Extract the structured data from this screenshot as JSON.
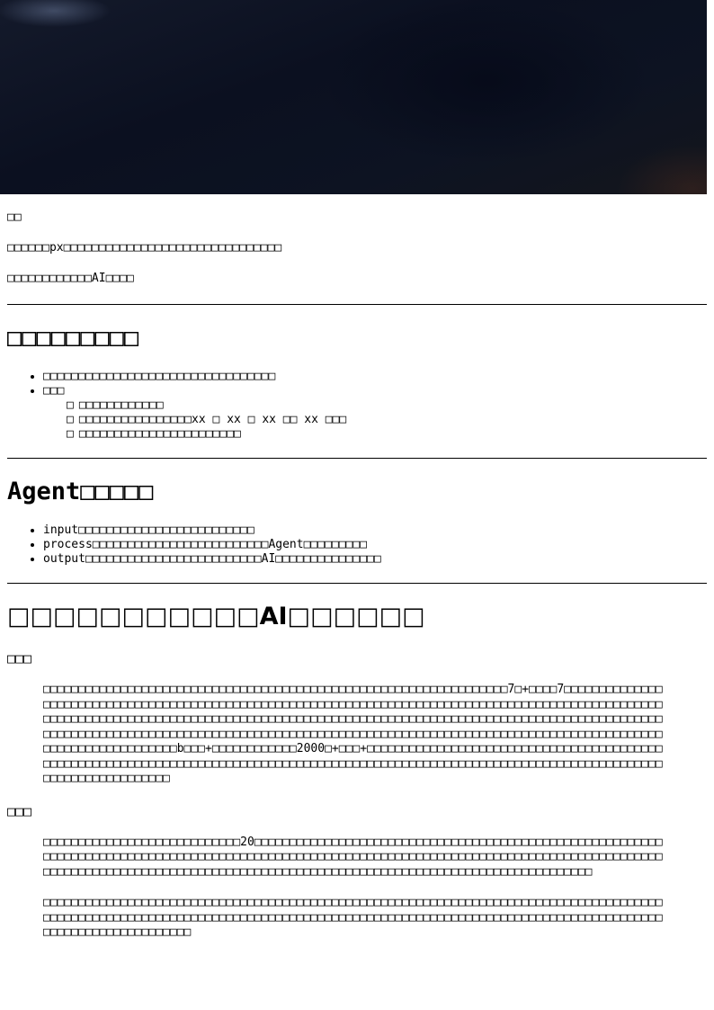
{
  "hero": {
    "image": "dark-night-banner"
  },
  "intro": {
    "line1": "□□",
    "line2_a": "□□□□□□px□□□□",
    "line2_b": "□□□□□□□□□",
    "line2_c": "□□□□□□□□□□□□□□□□□□",
    "line3": "□□□□□□□□□□□□AI□□□□"
  },
  "section1": {
    "title": "□□□□□□□□□",
    "items": [
      "□□□□□□□□□□□□□□□□□□□□□□□□□□□□□□□□□",
      "□□□"
    ],
    "subitems": [
      "□□□□□□□□□□□□",
      "□□□□□□□□□□□□□□□□xx □ xx □ xx □□ xx □□□",
      "□□□□□□□□□□□□□□□□□□□□□□□"
    ]
  },
  "section2": {
    "title": "Agent□□□□□",
    "items": [
      "input□□□□□□□□□□□□□□□□□□□□□□□□□",
      "process□□□□□□□□□□□□□□□□□□□□□□□□□Agent□□□□□□□□□",
      "output□□□□□□□□□□□□□□□□□□□□□□□□□AI□□□□□□□□□□□□□□□"
    ]
  },
  "section3": {
    "title": "□□□□□□□□□□□AI□□□□□□",
    "sub1": {
      "heading": "□□□",
      "body": "□□□□□□□□□□□□□□□□□□□□□□□□□□□□□□□□□□□□□□□□□□□□□□□□□□□□□□□□□□□□□□□□□□7□+□□□□7□□□□□□□□□□□□□□□□□□□□□□□□□□□□□□□□□□□□□□□□□□□□□□□□□□□□□□□□□□□□□□□□□□□□□□□□□□□□□□□□□□□□□□□□□□□□□□□□□□□□□□□□□□□□□□□□□□□□□□□□□□□□□□□□□□□□□□□□□□□□□□□□□□□□□□□□□□□□□□□□□□□□□□□□□□□□□□□□□□□□□□□□□□□□□□□□□□□□□□□□□□□□□□□□□□□□□□□□□□□□□□□□□□□□□□□□□□□□□□□□□□□□□□□□□□□□□□□□□□□□□□□□□□□□□□□□□□□□□□□□□□□□□□□□□□□□□□□□□b□□□+□□□□□□□□□□□□2000□+□□□+□□□□□□□□□□□□□□□□□□□□□□□□□□□□□□□□□□□□□□□□□□□□□□□□□□□□□□□□□□□□□□□□□□□□□□□□□□□□□□□□□□□□□□□□□□□□□□□□□□□□□□□□□□□□□□□□□□□□□□□□□□□□□□□□□□□□□□□□□□□□□□□□□□□□"
    },
    "sub2": {
      "heading": "□□□",
      "body1": "□□□□□□□□□□□□□□□□□□□□□□□□□□□□20□□□□□□□□□□□□□□□□□□□□□□□□□□□□□□□□□□□□□□□□□□□□□□□□□□□□□□□□□□□□□□□□□□□□□□□□□□□□□□□□□□□□□□□□□□□□□□□□□□□□□□□□□□□□□□□□□□□□□□□□□□□□□□□□□□□□□□□□□□□□□□□□□□□□□□□□□□□□□□□□□□□□□□□□□□□□□□□□□□□□□□□□□□□□□□□□□□□□□□□□□□□□□□□□□□□□□□□□□□□□□□□□",
      "body2": "□□□□□□□□□□□□□□□□□□□□□□□□□□□□□□□□□□□□□□□□□□□□□□□□□□□□□□□□□□□□□□□□□□□□□□□□□□□□□□□□□□□□□□□□□□□□□□□□□□□□□□□□□□□□□□□□□□□□□□□□□□□□□□□□□□□□□□□□□□□□□□□□□□□□□□□□□□□□□□□□□□□□□□□□□□□□□□□□□□□□□□□□□□□□□□□□□□□□□"
    }
  }
}
